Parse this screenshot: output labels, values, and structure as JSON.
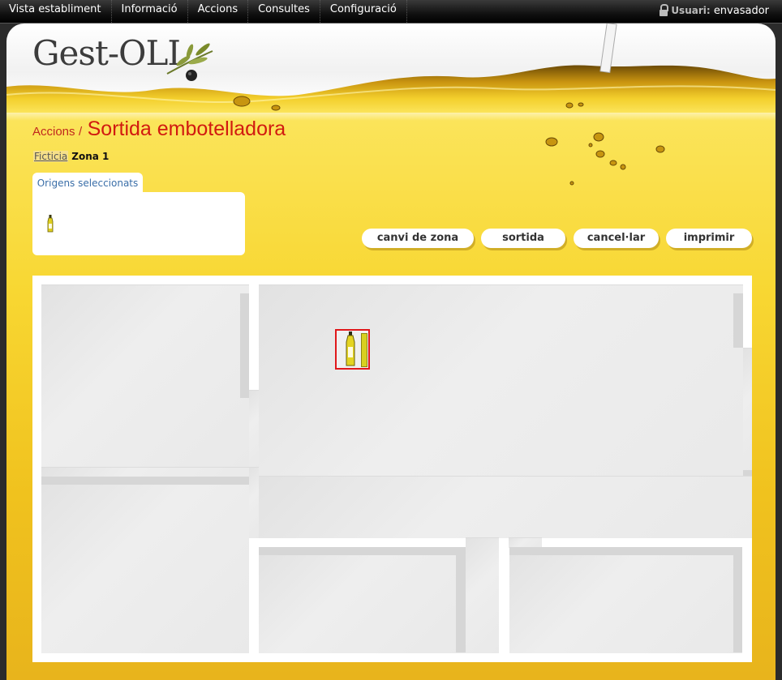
{
  "menu": {
    "items": [
      "Vista establiment",
      "Informació",
      "Accions",
      "Consultes",
      "Configuració"
    ]
  },
  "user": {
    "label": "Usuari:",
    "name": "envasador"
  },
  "app": {
    "logo": "Gest-OLI"
  },
  "heading": {
    "breadcrumb": "Accions",
    "separator": "/",
    "title": "Sortida embotelladora"
  },
  "zone_path": {
    "parent": "Ficticia",
    "current": "Zona 1"
  },
  "origins": {
    "tab_label": "Origens seleccionats"
  },
  "actions": {
    "change_zone": "canvi de zona",
    "exit": "sortida",
    "cancel": "cancel·lar",
    "print": "imprimir"
  },
  "colors": {
    "accent_red": "#d11a10",
    "oil_yellow": "#f8d732",
    "selection_border": "#e0181b"
  },
  "icons": [
    "lock-icon",
    "olive-branch-icon",
    "oil-bottle-icon"
  ]
}
